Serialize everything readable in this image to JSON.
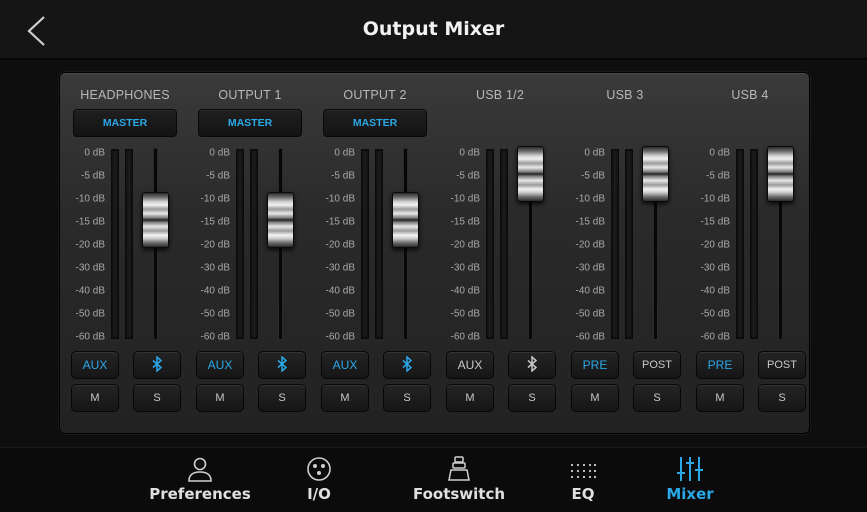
{
  "header": {
    "title": "Output Mixer"
  },
  "scale_ticks": [
    "0 dB",
    "-5 dB",
    "-10 dB",
    "-15 dB",
    "-20 dB",
    "-30 dB",
    "-40 dB",
    "-50 dB",
    "-60 dB"
  ],
  "channels": [
    {
      "label": "HEADPHONES",
      "master_label": "MASTER",
      "fader_level_db": -10,
      "btn1": "AUX",
      "btn1_active": true,
      "btn2": "bluetooth",
      "btn2_active": true,
      "mute": "M",
      "solo": "S"
    },
    {
      "label": "OUTPUT 1",
      "master_label": "MASTER",
      "fader_level_db": -10,
      "btn1": "AUX",
      "btn1_active": true,
      "btn2": "bluetooth",
      "btn2_active": true,
      "mute": "M",
      "solo": "S"
    },
    {
      "label": "OUTPUT 2",
      "master_label": "MASTER",
      "fader_level_db": -10,
      "btn1": "AUX",
      "btn1_active": true,
      "btn2": "bluetooth",
      "btn2_active": true,
      "mute": "M",
      "solo": "S"
    },
    {
      "label": "USB 1/2",
      "master_label": "",
      "fader_level_db": 0,
      "btn1": "AUX",
      "btn1_active": false,
      "btn2": "bluetooth",
      "btn2_active": false,
      "mute": "M",
      "solo": "S"
    },
    {
      "label": "USB 3",
      "master_label": "",
      "fader_level_db": 0,
      "btn1": "PRE",
      "btn1_active": true,
      "btn2": "POST",
      "btn2_active": false,
      "mute": "M",
      "solo": "S"
    },
    {
      "label": "USB 4",
      "master_label": "",
      "fader_level_db": 0,
      "btn1": "PRE",
      "btn1_active": true,
      "btn2": "POST",
      "btn2_active": false,
      "mute": "M",
      "solo": "S"
    }
  ],
  "nav": [
    {
      "label": "Preferences",
      "icon": "person-icon",
      "active": false
    },
    {
      "label": "I/O",
      "icon": "xlr-connector-icon",
      "active": false
    },
    {
      "label": "Footswitch",
      "icon": "footswitch-icon",
      "active": false
    },
    {
      "label": "EQ",
      "icon": "eq-dots-icon",
      "active": false
    },
    {
      "label": "Mixer",
      "icon": "mixer-sliders-icon",
      "active": true
    }
  ],
  "colors": {
    "accent": "#2aa8e8",
    "background": "#0e0e0e",
    "panel": "#2a2a2a"
  }
}
